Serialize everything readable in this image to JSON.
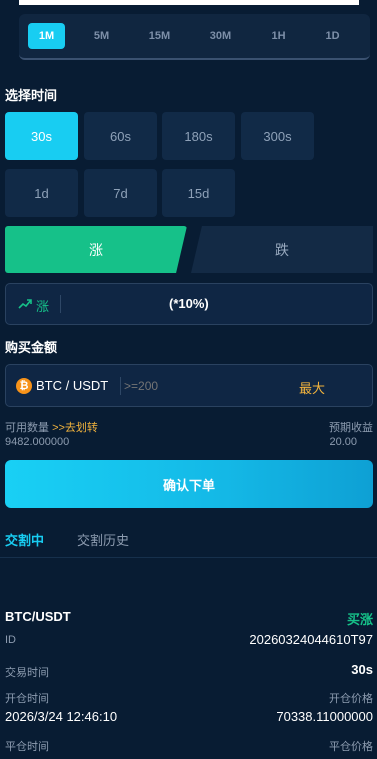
{
  "intervals": [
    "1M",
    "5M",
    "15M",
    "30M",
    "1H",
    "1D"
  ],
  "select_time": {
    "title": "选择时间",
    "options": [
      "30s",
      "60s",
      "180s",
      "300s",
      "1d",
      "7d",
      "15d"
    ]
  },
  "direction": {
    "up_label": "涨",
    "down_label": "跌",
    "selected_label": "涨",
    "rate": "(*10%)",
    "trend_icon": "trending-up-icon"
  },
  "purchase": {
    "title": "购买金额",
    "pair": "BTC / USDT",
    "coin_icon": "bitcoin-icon",
    "placeholder": ">=200",
    "max_label": "最大",
    "available_label": "可用数量",
    "transfer_link": ">>去划转",
    "available_value": "9482.000000",
    "expected_label": "预期收益",
    "expected_value": "20.00"
  },
  "confirm_label": "确认下单",
  "tabs": {
    "active": "交割中",
    "history": "交割历史"
  },
  "order": {
    "pair": "BTC/USDT",
    "side": "买涨",
    "id_label": "ID",
    "id_value": "20260324044610T97",
    "trade_time_label": "交易时间",
    "trade_time_value": "30s",
    "open_time_label": "开仓时间",
    "open_time_value": "2026/3/24 12:46:10",
    "open_price_label": "开仓价格",
    "open_price_value": "70338.11000000",
    "close_time_label": "平仓时间",
    "close_price_label": "平仓价格"
  },
  "colors": {
    "background": "#081c33",
    "accent": "#18cdf2",
    "up": "#16c189",
    "transfer": "#f2b33d",
    "bitcoin": "#f7931a"
  }
}
